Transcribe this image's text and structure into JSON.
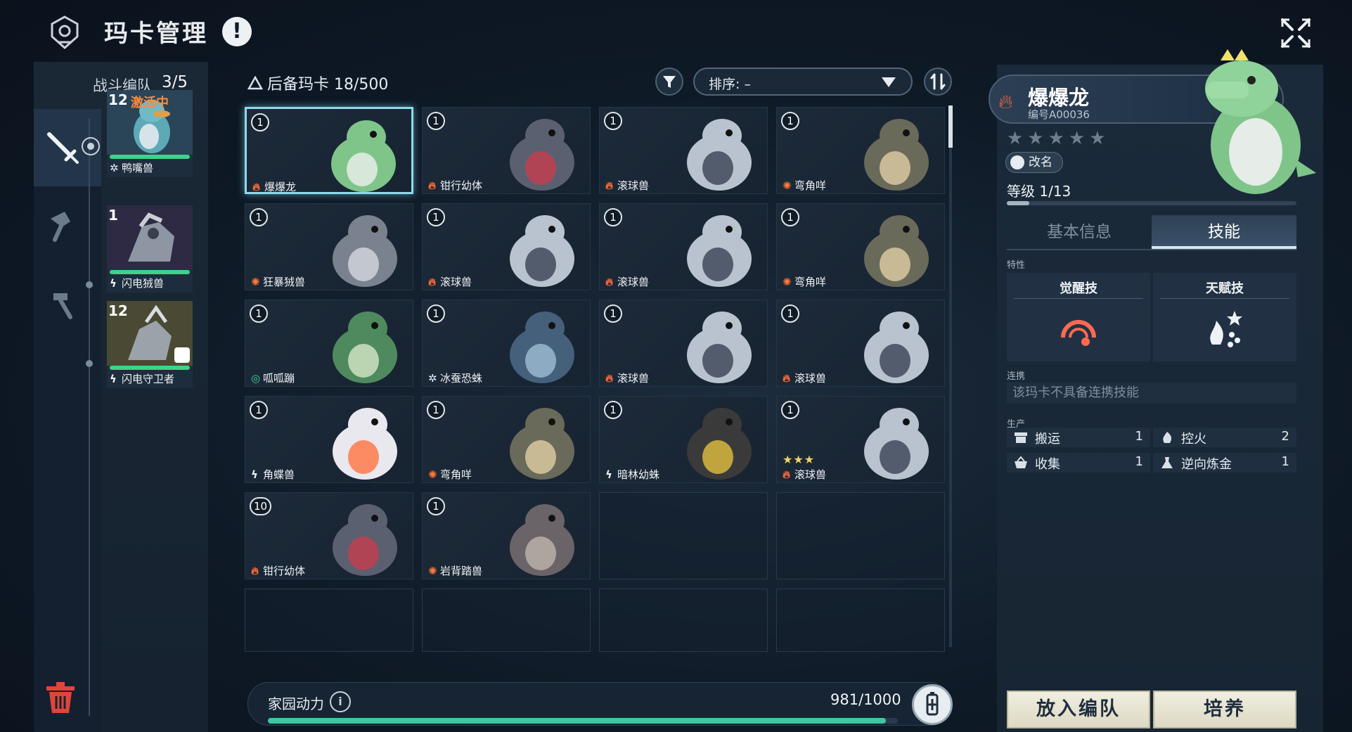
{
  "header": {
    "title": "玛卡管理",
    "alert_glyph": "!"
  },
  "sidebar": {
    "title": "战斗编队",
    "count": "3/5",
    "team": [
      {
        "level": "12",
        "tag": "激活中",
        "element": "ice",
        "name": "鸭嘴兽"
      },
      {
        "level": "1",
        "tag": "",
        "element": "elec",
        "name": "闪电狨兽"
      },
      {
        "level": "12",
        "tag": "",
        "element": "elec",
        "name": "闪电守卫者"
      }
    ]
  },
  "reserve": {
    "label": "后备玛卡",
    "count": "18/500"
  },
  "sort": {
    "label": "排序: –"
  },
  "cards": [
    {
      "level": "1",
      "element": "fire",
      "name": "爆爆龙",
      "stars": "",
      "selected": true
    },
    {
      "level": "1",
      "element": "fire",
      "name": "钳行幼体",
      "stars": ""
    },
    {
      "level": "1",
      "element": "fire",
      "name": "滚球兽",
      "stars": ""
    },
    {
      "level": "1",
      "element": "earth",
      "name": "弯角咩",
      "stars": ""
    },
    {
      "level": "1",
      "element": "earth",
      "name": "狂暴狨兽",
      "stars": ""
    },
    {
      "level": "1",
      "element": "fire",
      "name": "滚球兽",
      "stars": ""
    },
    {
      "level": "1",
      "element": "fire",
      "name": "滚球兽",
      "stars": ""
    },
    {
      "level": "1",
      "element": "earth",
      "name": "弯角咩",
      "stars": ""
    },
    {
      "level": "1",
      "element": "wind",
      "name": "呱呱蹦",
      "stars": ""
    },
    {
      "level": "1",
      "element": "ice",
      "name": "冰蚕恐蛛",
      "stars": ""
    },
    {
      "level": "1",
      "element": "fire",
      "name": "滚球兽",
      "stars": ""
    },
    {
      "level": "1",
      "element": "fire",
      "name": "滚球兽",
      "stars": ""
    },
    {
      "level": "1",
      "element": "elec",
      "name": "角蝶兽",
      "stars": ""
    },
    {
      "level": "1",
      "element": "earth",
      "name": "弯角咩",
      "stars": ""
    },
    {
      "level": "1",
      "element": "elec",
      "name": "暗林幼蛛",
      "stars": ""
    },
    {
      "level": "1",
      "element": "fire",
      "name": "滚球兽",
      "stars": "★★★"
    },
    {
      "level": "10",
      "element": "fire",
      "name": "钳行幼体",
      "stars": ""
    },
    {
      "level": "1",
      "element": "earth",
      "name": "岩背踏兽",
      "stars": ""
    }
  ],
  "energy": {
    "label": "家园动力",
    "value": "981/1000",
    "fraction": 0.981,
    "info_glyph": "i"
  },
  "detail": {
    "name": "爆爆龙",
    "id": "编号A00036",
    "stars": "★★★★★",
    "rename": "改名",
    "level": "等级 1/13",
    "level_fraction": 0.077,
    "tabs": [
      "基本信息",
      "技能"
    ],
    "traits_label": "特性",
    "awaken_skill": "觉醒技",
    "talent_skill": "天赋技",
    "link_label": "连携",
    "link_text": "该玛卡不具备连携技能",
    "production_label": "生产",
    "production": [
      {
        "name": "搬运",
        "value": "1",
        "icon": "box-icon"
      },
      {
        "name": "控火",
        "value": "2",
        "icon": "flame-icon"
      },
      {
        "name": "收集",
        "value": "1",
        "icon": "basket-icon"
      },
      {
        "name": "逆向炼金",
        "value": "1",
        "icon": "flask-icon"
      }
    ],
    "deploy_button": "放入编队",
    "train_button": "培养"
  },
  "colors": {
    "accent_teal": "#3cc9a2",
    "fire": "#ff6a3a",
    "selected_border": "#8fd9ea",
    "active_tag": "#ff8a3a"
  }
}
